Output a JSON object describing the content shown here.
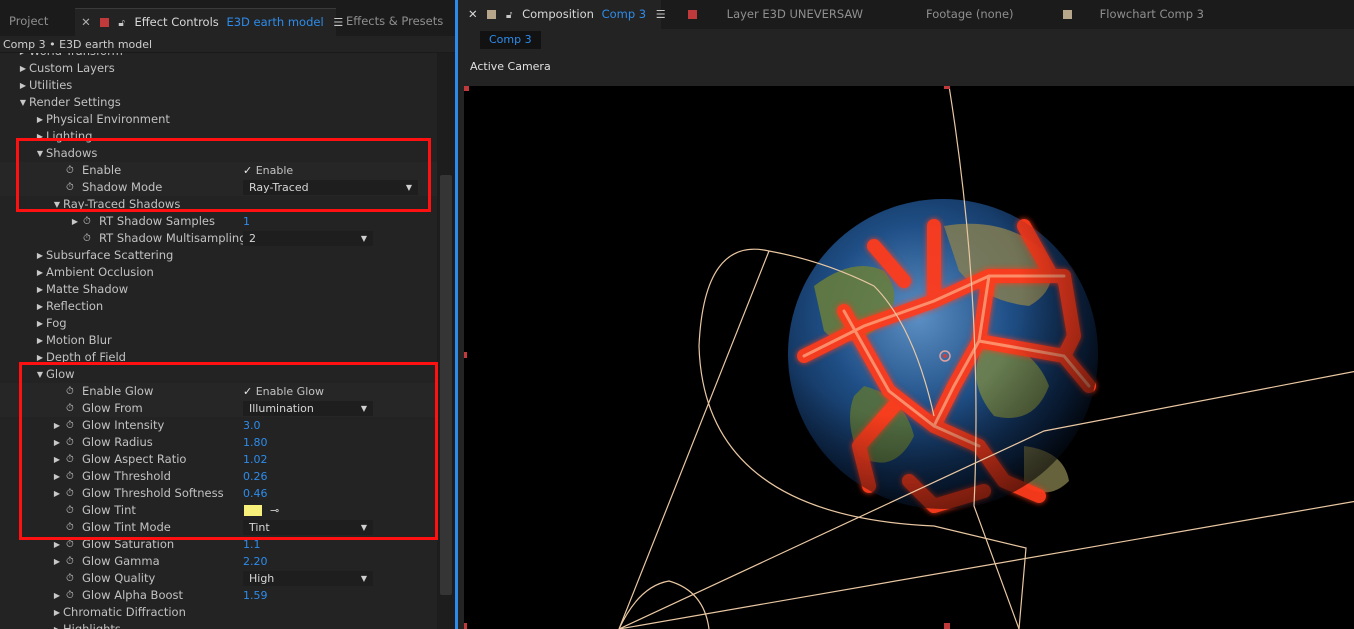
{
  "left_panel": {
    "tabs": {
      "project": "Project",
      "effect_controls": "Effect Controls",
      "effect_controls_layer": "E3D earth model",
      "effects_presets": "Effects & Presets"
    },
    "breadcrumb": "Comp 3 • E3D earth model",
    "rows": [
      {
        "label": "World Transform",
        "tri": "▶",
        "indent": 1
      },
      {
        "label": "Custom Layers",
        "tri": "▶",
        "indent": 1
      },
      {
        "label": "Utilities",
        "tri": "▶",
        "indent": 1
      },
      {
        "label": "Render Settings",
        "tri": "▼",
        "indent": 1
      },
      {
        "label": "Physical Environment",
        "tri": "▶",
        "indent": 2
      },
      {
        "label": "Lighting",
        "tri": "▶",
        "indent": 2
      },
      {
        "label": "Shadows",
        "tri": "▼",
        "indent": 2
      },
      {
        "label": "Enable",
        "sw": true,
        "indent": 4,
        "check": "Enable",
        "hl": true
      },
      {
        "label": "Shadow Mode",
        "sw": true,
        "indent": 4,
        "dropdown": "Ray-Traced",
        "dd_w": 175,
        "hl": true
      },
      {
        "label": "Ray-Traced Shadows",
        "tri": "▼",
        "indent": 3
      },
      {
        "label": "RT Shadow Samples",
        "tri": "▶",
        "sw": true,
        "indent": 4.5,
        "num": "1"
      },
      {
        "label": "RT Shadow Multisampling",
        "sw": true,
        "indent": 5.5,
        "dropdown": "2",
        "dd_w": 130
      },
      {
        "label": "Subsurface Scattering",
        "tri": "▶",
        "indent": 2
      },
      {
        "label": "Ambient Occlusion",
        "tri": "▶",
        "indent": 2
      },
      {
        "label": "Matte Shadow",
        "tri": "▶",
        "indent": 2
      },
      {
        "label": "Reflection",
        "tri": "▶",
        "indent": 2
      },
      {
        "label": "Fog",
        "tri": "▶",
        "indent": 2
      },
      {
        "label": "Motion Blur",
        "tri": "▶",
        "indent": 2
      },
      {
        "label": "Depth of Field",
        "tri": "▶",
        "indent": 2
      },
      {
        "label": "Glow",
        "tri": "▼",
        "indent": 2
      },
      {
        "label": "Enable Glow",
        "sw": true,
        "indent": 4,
        "check": "Enable Glow",
        "hl": true
      },
      {
        "label": "Glow From",
        "sw": true,
        "indent": 4,
        "dropdown": "Illumination",
        "dd_w": 130,
        "hl": true
      },
      {
        "label": "Glow Intensity",
        "tri": "▶",
        "sw": true,
        "indent": 3,
        "num": "3.0"
      },
      {
        "label": "Glow Radius",
        "tri": "▶",
        "sw": true,
        "indent": 3,
        "num": "1.80"
      },
      {
        "label": "Glow Aspect Ratio",
        "tri": "▶",
        "sw": true,
        "indent": 3,
        "num": "1.02"
      },
      {
        "label": "Glow Threshold",
        "tri": "▶",
        "sw": true,
        "indent": 3,
        "num": "0.26"
      },
      {
        "label": "Glow Threshold Softness",
        "tri": "▶",
        "sw": true,
        "indent": 3,
        "num": "0.46"
      },
      {
        "label": "Glow Tint",
        "sw": true,
        "indent": 4,
        "swatch": "#f7f07a"
      },
      {
        "label": "Glow Tint Mode",
        "sw": true,
        "indent": 4,
        "dropdown": "Tint",
        "dd_w": 130
      },
      {
        "label": "Glow Saturation",
        "tri": "▶",
        "sw": true,
        "indent": 3,
        "num": "1.1"
      },
      {
        "label": "Glow Gamma",
        "tri": "▶",
        "sw": true,
        "indent": 3,
        "num": "2.20"
      },
      {
        "label": "Glow Quality",
        "sw": true,
        "indent": 4,
        "dropdown": "High",
        "dd_w": 130
      },
      {
        "label": "Glow Alpha Boost",
        "tri": "▶",
        "sw": true,
        "indent": 3,
        "num": "1.59"
      },
      {
        "label": "Chromatic Diffraction",
        "tri": "▶",
        "indent": 3
      },
      {
        "label": "Highlights",
        "tri": "▶",
        "indent": 3
      }
    ]
  },
  "right_panel": {
    "tabs": {
      "composition": "Composition",
      "composition_name": "Comp 3",
      "layer": "Layer  E3D UNEVERSAW",
      "footage": "Footage  (none)",
      "flowchart": "Flowchart  Comp 3"
    },
    "comp_subtab": "Comp 3",
    "camera_label": "Active Camera"
  },
  "colors": {
    "accent": "#2d8ceb",
    "highlight_box": "#ff1111",
    "glow_tint": "#f7f07a",
    "layer_color": "#c0393b",
    "footage_color": "#b8a68a"
  }
}
